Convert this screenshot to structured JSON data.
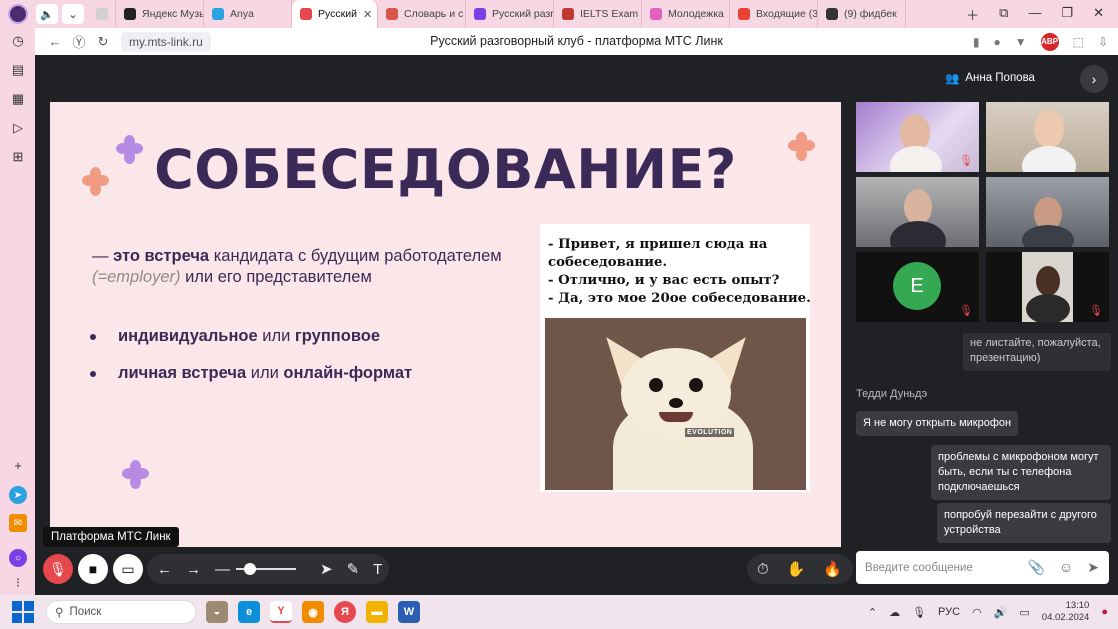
{
  "browser": {
    "tabs": [
      {
        "label": "",
        "color": "#d0d0d0"
      },
      {
        "label": "Яндекс Музы",
        "color": "#222222"
      },
      {
        "label": "Anya",
        "color": "#2aa3e0"
      },
      {
        "label": "Русский",
        "color": "#e5484d",
        "active": true
      },
      {
        "label": "Словарь и с",
        "color": "#d9534f"
      },
      {
        "label": "Русский разг",
        "color": "#7b3fe4"
      },
      {
        "label": "IELTS Exam -",
        "color": "#c0392b"
      },
      {
        "label": "Молодежка",
        "color": "#e060c0"
      },
      {
        "label": "Входящие (3",
        "color": "#ea4335"
      },
      {
        "label": "(9) фидбек",
        "color": "#333333"
      }
    ],
    "url": "my.mts-link.ru",
    "page_title": "Русский разговорный клуб - платформа МТС Линк",
    "abp": "ABP"
  },
  "conference": {
    "user_name": "Анна Попова",
    "tooltip": "Платформа МТС Линк"
  },
  "slide": {
    "title": "СОБЕСЕДОВАНИЕ?",
    "def_dash": "— ",
    "def_bold": "это встреча",
    "def_rest": " кандидата с будущим работодателем ",
    "def_italic": "(=employer)",
    "def_end": " или его представителем",
    "bullet1_a": "индивидуальное",
    "bullet1_or": " или ",
    "bullet1_b": "групповое",
    "bullet2_a": "личная встреча",
    "bullet2_or": " или ",
    "bullet2_b": "онлайн-формат",
    "meme_text": "- Привет, я пришел сюда на\nсобеседование.\n- Отлично, и у вас есть опыт?\n- Да, это мое 20ое собеседование.",
    "meme_watermark": "EVOLUTION"
  },
  "participants": {
    "avatar_letter": "E"
  },
  "chat": {
    "msg_partial": "не листайте, пожалуйста,\nпрезентацию)",
    "sender": "Тедди Дуньдэ",
    "msg1": "Я не могу открыть микрофон",
    "msg2": "проблемы с микрофоном могут\nбыть, если ты с телефона\nподключаешься",
    "msg3": "попробуй перезайти с другого\nустройства",
    "placeholder": "Введите сообщение"
  },
  "taskbar": {
    "search": "Поиск",
    "lang": "РУС",
    "time": "13:10",
    "date": "04.02.2024"
  }
}
